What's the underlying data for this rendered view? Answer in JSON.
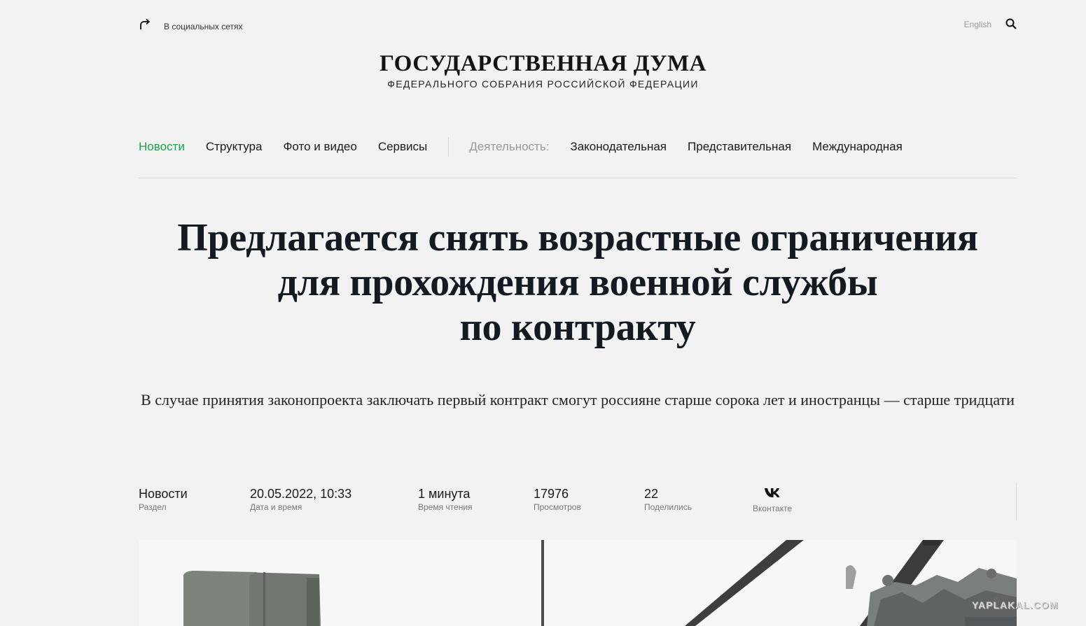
{
  "header": {
    "share_label": "В социальных сетях",
    "lang_label": "English",
    "brand_title": "ГОСУДАРСТВЕННАЯ ДУМА",
    "brand_subtitle": "ФЕДЕРАЛЬНОГО СОБРАНИЯ РОССИЙСКОЙ ФЕДЕРАЦИИ"
  },
  "nav": {
    "items": [
      {
        "label": "Новости",
        "active": true
      },
      {
        "label": "Структура"
      },
      {
        "label": "Фото и видео"
      },
      {
        "label": "Сервисы"
      }
    ],
    "activity_label": "Деятельность:",
    "activity_items": [
      {
        "label": "Законодательная"
      },
      {
        "label": "Представительная"
      },
      {
        "label": "Международная"
      }
    ]
  },
  "article": {
    "title_lines": [
      "Предлагается снять возрастные ограничения",
      "для прохождения военной службы",
      "по контракту"
    ],
    "lede": "В случае принятия законопроекта заключать первый контракт смогут россияне старше сорока лет и иностранцы — старше тридцати",
    "meta": [
      {
        "value": "Новости",
        "label": "Раздел"
      },
      {
        "value": "20.05.2022, 10:33",
        "label": "Дата и время"
      },
      {
        "value": "1 минута",
        "label": "Время чтения"
      },
      {
        "value": "17976",
        "label": "Просмотров"
      },
      {
        "value": "22",
        "label": "Поделились"
      }
    ],
    "share_vk_label": "Вконтакте"
  },
  "watermark": "YAPLAKAL.COM",
  "colors": {
    "accent": "#1ea14d",
    "background": "#f2f2f2",
    "text": "#141a22",
    "muted": "#999999"
  },
  "icons": {
    "share": "share-arrow-icon",
    "search": "search-icon",
    "vk": "vk-icon"
  }
}
